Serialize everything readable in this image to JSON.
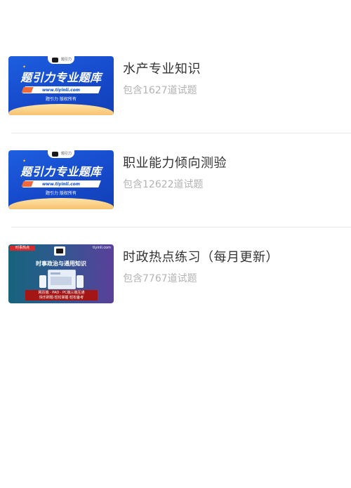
{
  "banks": [
    {
      "title": "水产专业知识",
      "count": "包含1627道试题",
      "thumb": {
        "style": "blue",
        "tab_text": "题引力",
        "headline": "题引力专业题库",
        "url": "www.tiyinli.com",
        "copyright": "题引力 版权所有"
      }
    },
    {
      "title": "职业能力倾向测验",
      "count": "包含12622道试题",
      "thumb": {
        "style": "blue",
        "tab_text": "题引力",
        "headline": "题引力专业题库",
        "url": "www.tiyinli.com",
        "copyright": "题引力 版权所有"
      }
    },
    {
      "title": "时政热点练习（每月更新）",
      "count": "包含7767道试题",
      "thumb": {
        "style": "gradient",
        "badge": "时事热点",
        "site": "tiyinli.com",
        "headline": "时事政治与通用知识",
        "line1": "网页端 · PAD · PC端三端互通",
        "line2": "快乐刷题·轻松掌握·轻松备考"
      }
    }
  ],
  "colors": {
    "title": "#333333",
    "count": "#b3b3b3",
    "divider": "#e6e6e6",
    "thumb_blue": "#1548c9",
    "thumb_gold": "#f7c270",
    "thumb_red": "#a41616"
  }
}
